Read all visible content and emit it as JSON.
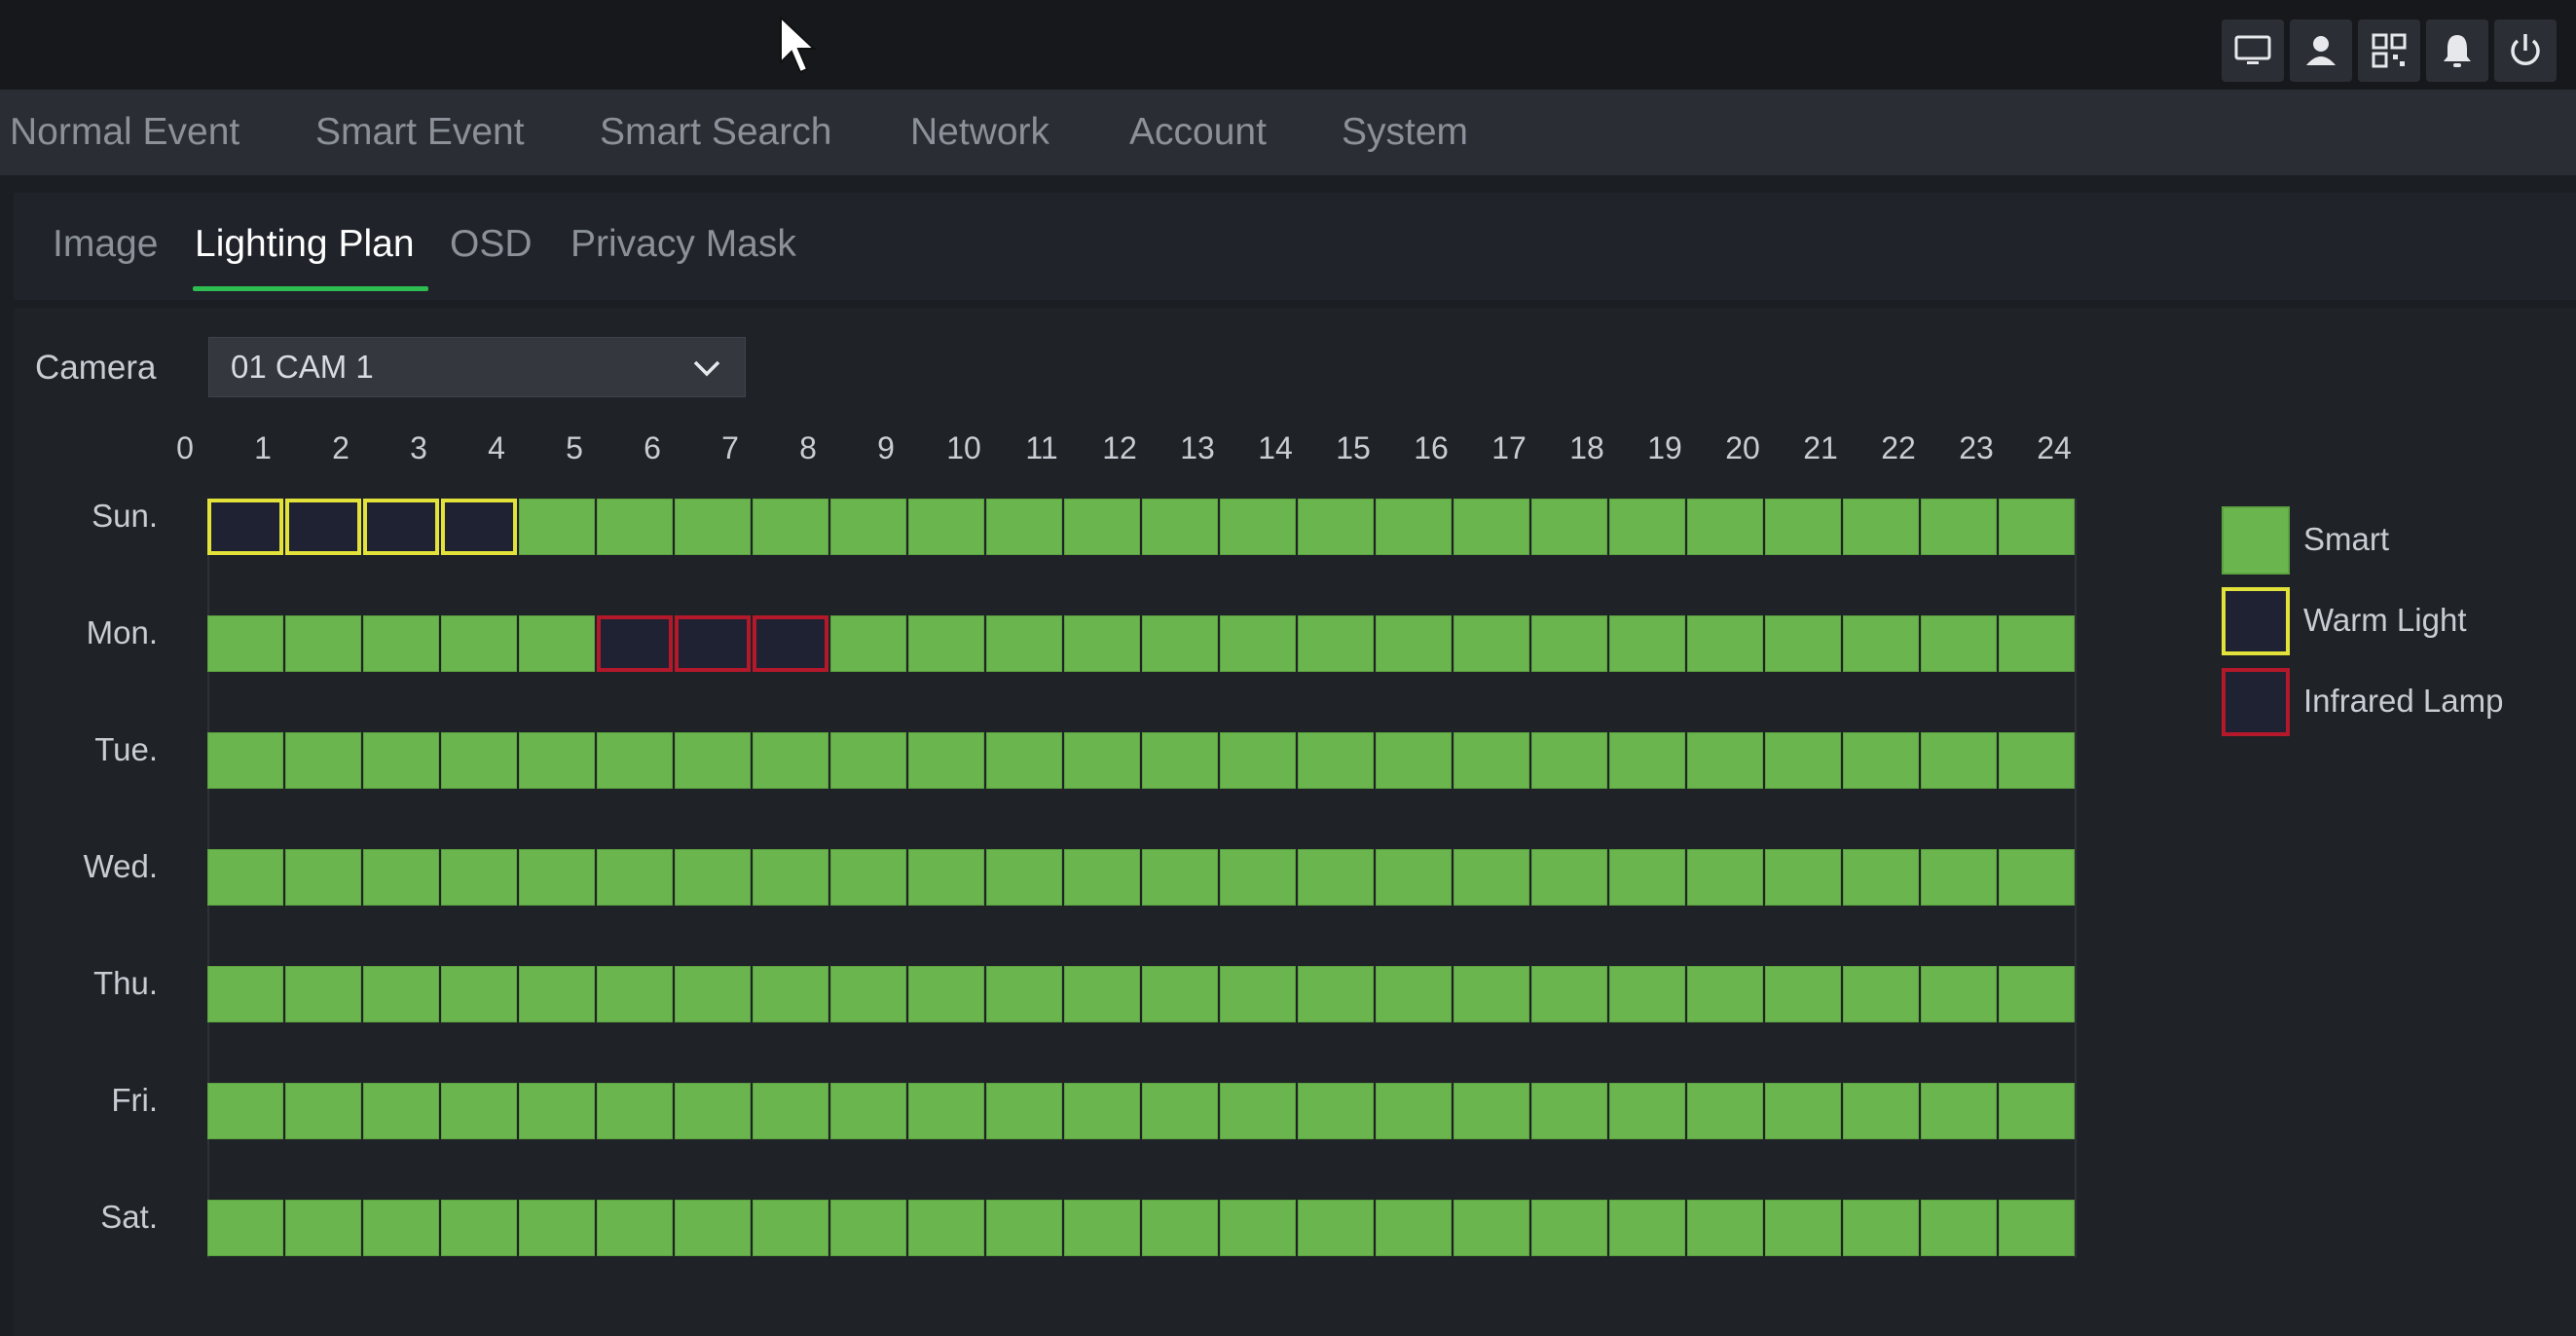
{
  "topbar": {
    "icons": [
      "monitor-icon",
      "user-icon",
      "qr-code-icon",
      "alarm-bell-icon",
      "power-icon"
    ]
  },
  "nav": {
    "items": [
      {
        "label": "Normal Event"
      },
      {
        "label": "Smart Event"
      },
      {
        "label": "Smart Search"
      },
      {
        "label": "Network"
      },
      {
        "label": "Account"
      },
      {
        "label": "System"
      }
    ]
  },
  "subnav": {
    "tabs": [
      {
        "label": "Image"
      },
      {
        "label": "Lighting Plan",
        "active": true
      },
      {
        "label": "OSD"
      },
      {
        "label": "Privacy Mask"
      }
    ]
  },
  "camera": {
    "label": "Camera",
    "selected": "01 CAM 1"
  },
  "schedule": {
    "hours": [
      "0",
      "1",
      "2",
      "3",
      "4",
      "5",
      "6",
      "7",
      "8",
      "9",
      "10",
      "11",
      "12",
      "13",
      "14",
      "15",
      "16",
      "17",
      "18",
      "19",
      "20",
      "21",
      "22",
      "23",
      "24"
    ],
    "days": [
      {
        "label": "Sun.",
        "cells": [
          "warm",
          "warm",
          "warm",
          "warm",
          "smart",
          "smart",
          "smart",
          "smart",
          "smart",
          "smart",
          "smart",
          "smart",
          "smart",
          "smart",
          "smart",
          "smart",
          "smart",
          "smart",
          "smart",
          "smart",
          "smart",
          "smart",
          "smart",
          "smart"
        ]
      },
      {
        "label": "Mon.",
        "cells": [
          "smart",
          "smart",
          "smart",
          "smart",
          "smart",
          "ir",
          "ir",
          "ir",
          "smart",
          "smart",
          "smart",
          "smart",
          "smart",
          "smart",
          "smart",
          "smart",
          "smart",
          "smart",
          "smart",
          "smart",
          "smart",
          "smart",
          "smart",
          "smart"
        ]
      },
      {
        "label": "Tue.",
        "cells": [
          "smart",
          "smart",
          "smart",
          "smart",
          "smart",
          "smart",
          "smart",
          "smart",
          "smart",
          "smart",
          "smart",
          "smart",
          "smart",
          "smart",
          "smart",
          "smart",
          "smart",
          "smart",
          "smart",
          "smart",
          "smart",
          "smart",
          "smart",
          "smart"
        ]
      },
      {
        "label": "Wed.",
        "cells": [
          "smart",
          "smart",
          "smart",
          "smart",
          "smart",
          "smart",
          "smart",
          "smart",
          "smart",
          "smart",
          "smart",
          "smart",
          "smart",
          "smart",
          "smart",
          "smart",
          "smart",
          "smart",
          "smart",
          "smart",
          "smart",
          "smart",
          "smart",
          "smart"
        ]
      },
      {
        "label": "Thu.",
        "cells": [
          "smart",
          "smart",
          "smart",
          "smart",
          "smart",
          "smart",
          "smart",
          "smart",
          "smart",
          "smart",
          "smart",
          "smart",
          "smart",
          "smart",
          "smart",
          "smart",
          "smart",
          "smart",
          "smart",
          "smart",
          "smart",
          "smart",
          "smart",
          "smart"
        ]
      },
      {
        "label": "Fri.",
        "cells": [
          "smart",
          "smart",
          "smart",
          "smart",
          "smart",
          "smart",
          "smart",
          "smart",
          "smart",
          "smart",
          "smart",
          "smart",
          "smart",
          "smart",
          "smart",
          "smart",
          "smart",
          "smart",
          "smart",
          "smart",
          "smart",
          "smart",
          "smart",
          "smart"
        ]
      },
      {
        "label": "Sat.",
        "cells": [
          "smart",
          "smart",
          "smart",
          "smart",
          "smart",
          "smart",
          "smart",
          "smart",
          "smart",
          "smart",
          "smart",
          "smart",
          "smart",
          "smart",
          "smart",
          "smart",
          "smart",
          "smart",
          "smart",
          "smart",
          "smart",
          "smart",
          "smart",
          "smart"
        ]
      }
    ]
  },
  "legend": {
    "smart": {
      "label": "Smart",
      "color": "#6ab54d"
    },
    "warm": {
      "label": "Warm Light",
      "color": "#e2e23a"
    },
    "ir": {
      "label": "Infrared Lamp",
      "color": "#b3192a"
    }
  }
}
